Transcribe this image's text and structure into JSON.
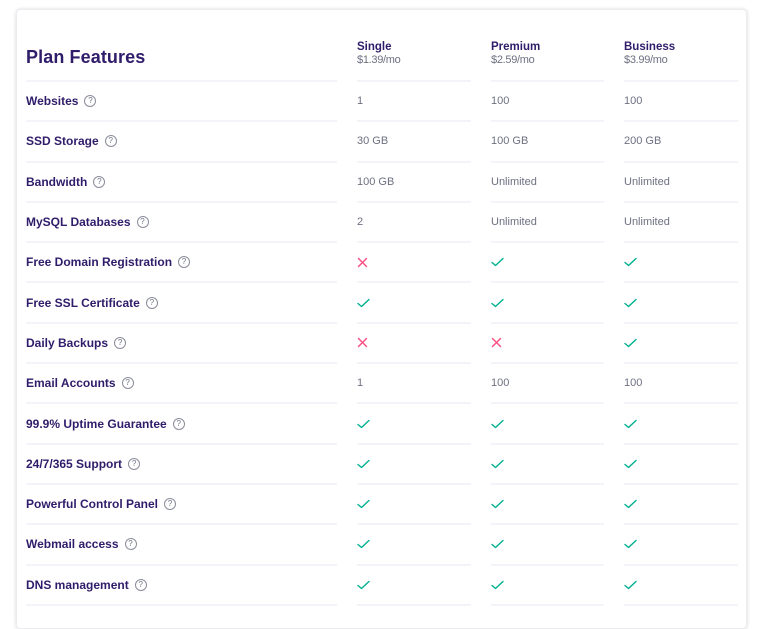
{
  "table": {
    "title": "Plan Features",
    "help_icon_glyph": "?",
    "plans": [
      {
        "name": "Single",
        "price": "$1.39/mo"
      },
      {
        "name": "Premium",
        "price": "$2.59/mo"
      },
      {
        "name": "Business",
        "price": "$3.99/mo"
      }
    ],
    "colors": {
      "check": "#00b090",
      "cross": "#fc5185",
      "title": "#2f1c6a",
      "value": "#6d7081"
    },
    "rows": [
      {
        "feature": "Websites",
        "values": [
          {
            "type": "text",
            "text": "1"
          },
          {
            "type": "text",
            "text": "100"
          },
          {
            "type": "text",
            "text": "100"
          }
        ]
      },
      {
        "feature": "SSD Storage",
        "values": [
          {
            "type": "text",
            "text": "30 GB"
          },
          {
            "type": "text",
            "text": "100 GB"
          },
          {
            "type": "text",
            "text": "200 GB"
          }
        ]
      },
      {
        "feature": "Bandwidth",
        "values": [
          {
            "type": "text",
            "text": "100 GB"
          },
          {
            "type": "text",
            "text": "Unlimited"
          },
          {
            "type": "text",
            "text": "Unlimited"
          }
        ]
      },
      {
        "feature": "MySQL Databases",
        "values": [
          {
            "type": "text",
            "text": "2"
          },
          {
            "type": "text",
            "text": "Unlimited"
          },
          {
            "type": "text",
            "text": "Unlimited"
          }
        ]
      },
      {
        "feature": "Free Domain Registration",
        "values": [
          {
            "type": "cross-icon"
          },
          {
            "type": "check-icon"
          },
          {
            "type": "check-icon"
          }
        ]
      },
      {
        "feature": "Free SSL Certificate",
        "values": [
          {
            "type": "check-icon"
          },
          {
            "type": "check-icon"
          },
          {
            "type": "check-icon"
          }
        ]
      },
      {
        "feature": "Daily Backups",
        "values": [
          {
            "type": "cross-icon"
          },
          {
            "type": "cross-icon"
          },
          {
            "type": "check-icon"
          }
        ]
      },
      {
        "feature": "Email Accounts",
        "values": [
          {
            "type": "text",
            "text": "1"
          },
          {
            "type": "text",
            "text": "100"
          },
          {
            "type": "text",
            "text": "100"
          }
        ]
      },
      {
        "feature": "99.9% Uptime Guarantee",
        "values": [
          {
            "type": "check-icon"
          },
          {
            "type": "check-icon"
          },
          {
            "type": "check-icon"
          }
        ]
      },
      {
        "feature": "24/7/365 Support",
        "values": [
          {
            "type": "check-icon"
          },
          {
            "type": "check-icon"
          },
          {
            "type": "check-icon"
          }
        ]
      },
      {
        "feature": "Powerful Control Panel",
        "values": [
          {
            "type": "check-icon"
          },
          {
            "type": "check-icon"
          },
          {
            "type": "check-icon"
          }
        ]
      },
      {
        "feature": "Webmail access",
        "values": [
          {
            "type": "check-icon"
          },
          {
            "type": "check-icon"
          },
          {
            "type": "check-icon"
          }
        ]
      },
      {
        "feature": "DNS management",
        "values": [
          {
            "type": "check-icon"
          },
          {
            "type": "check-icon"
          },
          {
            "type": "check-icon"
          }
        ]
      }
    ]
  }
}
